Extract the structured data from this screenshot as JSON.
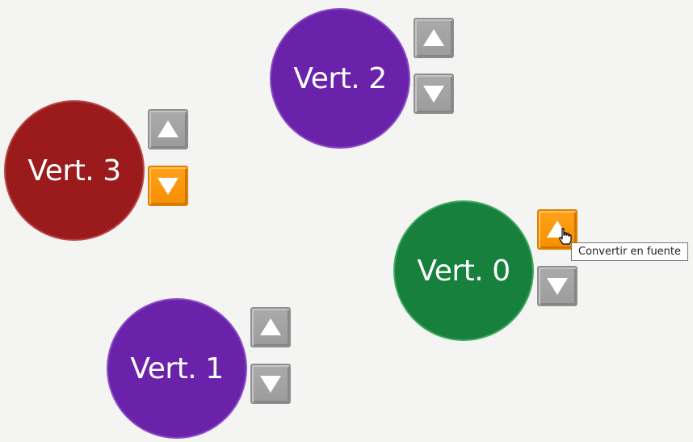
{
  "vertices": [
    {
      "label": "Vert. 2",
      "color": "#6b22aa"
    },
    {
      "label": "Vert. 3",
      "color": "#9b1b1c"
    },
    {
      "label": "Vert. 0",
      "color": "#17803c"
    },
    {
      "label": "Vert. 1",
      "color": "#6b22aa"
    }
  ],
  "buttons": {
    "up_icon": "triangle-up-icon",
    "down_icon": "triangle-down-icon",
    "active_color": "#f59300",
    "inactive_color": "#a3a3a3"
  },
  "tooltip": {
    "text": "Convertir en fuente"
  }
}
